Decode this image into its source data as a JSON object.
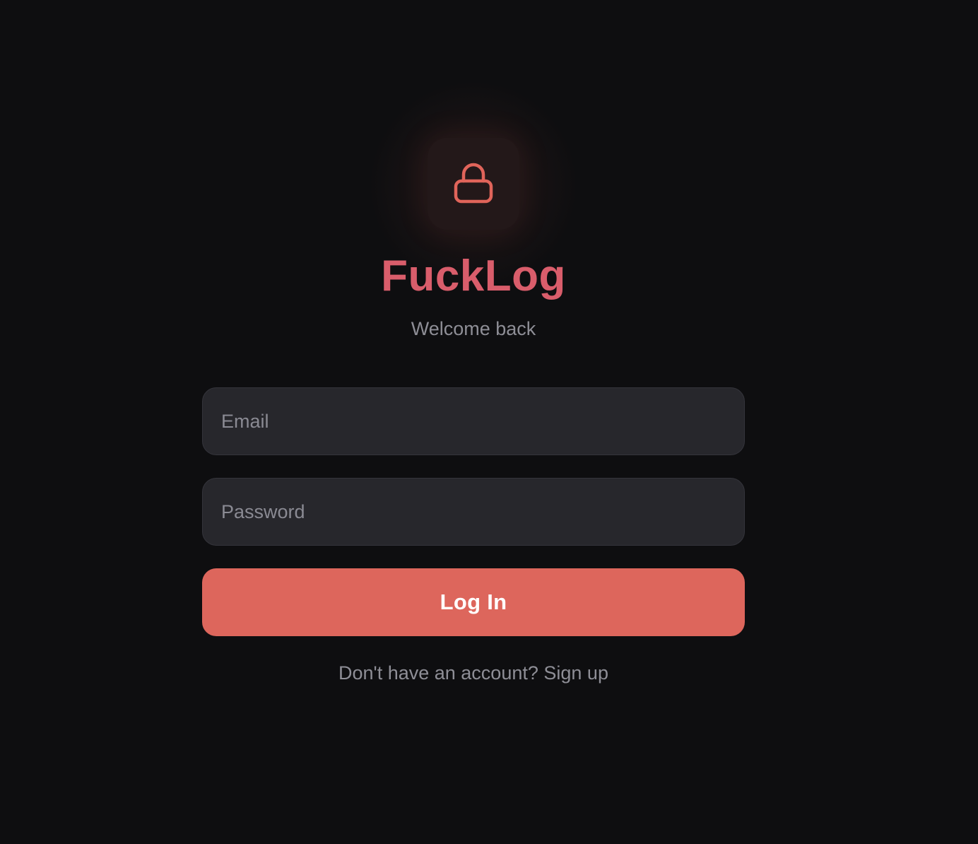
{
  "app": {
    "title": "FuckLog",
    "subtitle": "Welcome back",
    "logo_icon": "lock-icon"
  },
  "form": {
    "email_placeholder": "Email",
    "email_value": "",
    "password_placeholder": "Password",
    "password_value": "",
    "submit_label": "Log In"
  },
  "footer": {
    "prompt": "Don't have an account?",
    "signup_link": "Sign up"
  },
  "colors": {
    "background": "#0e0e10",
    "accent": "#dd665c",
    "title": "#d95d6b",
    "muted_text": "#8e8e96",
    "field_background": "#27272c"
  }
}
